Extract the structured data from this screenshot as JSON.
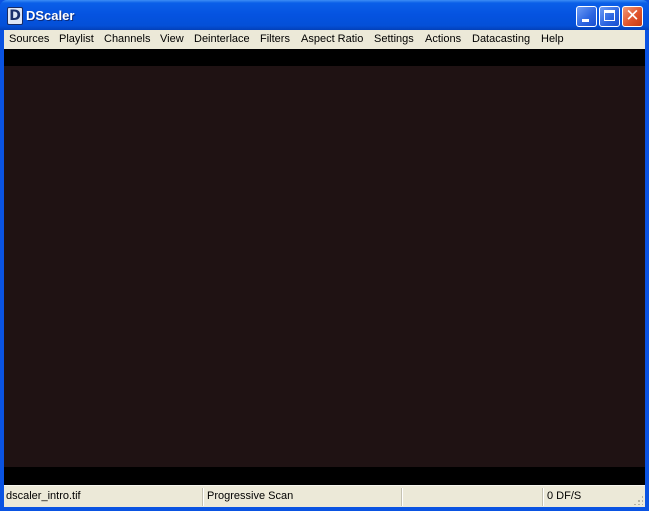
{
  "window": {
    "title": "DScaler",
    "app_icon_glyph": "D",
    "icons": {
      "app": "dscaler-app-icon",
      "minimize": "minimize-icon",
      "maximize": "maximize-icon",
      "close": "close-icon"
    },
    "close_glyph": "✕"
  },
  "menubar": {
    "items": [
      {
        "label": "Sources"
      },
      {
        "label": "Playlist"
      },
      {
        "label": "Channels"
      },
      {
        "label": "View"
      },
      {
        "label": "Deinterlace"
      },
      {
        "label": "Filters"
      },
      {
        "label": "Aspect Ratio"
      },
      {
        "label": "Settings"
      },
      {
        "label": "Actions"
      },
      {
        "label": "Datacasting"
      },
      {
        "label": "Help"
      }
    ]
  },
  "video": {
    "background_color": "#1f1213"
  },
  "statusbar": {
    "file": "dscaler_intro.tif",
    "mode": "Progressive Scan",
    "empty": "",
    "rate": "0 DF/S"
  }
}
